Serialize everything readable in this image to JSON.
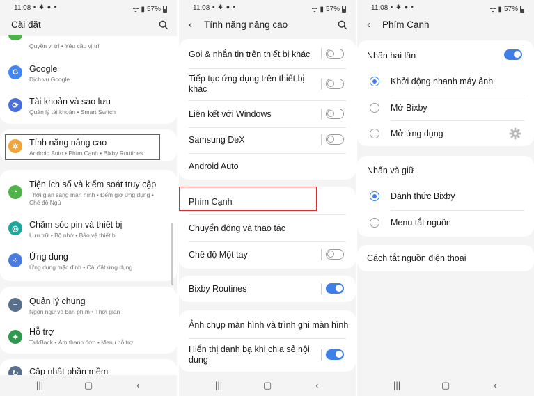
{
  "status_bar": {
    "time": "11:08",
    "battery": "57%"
  },
  "screen1": {
    "title": "Cài đặt",
    "partial_top_sub": "Quyền vị trí  •  Yêu cầu vị trí",
    "items": [
      {
        "label": "Google",
        "sub": "Dịch vụ Google",
        "icon": "google-icon",
        "color": "#4285f4"
      },
      {
        "label": "Tài khoản và sao lưu",
        "sub": "Quản lý tài khoản  •  Smart Switch",
        "icon": "sync-icon",
        "color": "#4a6fd8"
      },
      {
        "label": "Tính năng nâng cao",
        "sub": "Android Auto  •  Phím Cạnh  •  Bixby Routines",
        "icon": "star-gear-icon",
        "color": "#f0a43a"
      },
      {
        "label": "Tiện ích số và kiểm soát truy cập",
        "sub": "Thời gian sáng màn hình  •  Đếm giờ ứng dụng  •  Chế độ Ngủ",
        "icon": "digital-wellbeing-icon",
        "color": "#4fb34a"
      },
      {
        "label": "Chăm sóc pin và thiết bị",
        "sub": "Lưu trữ  •  Bộ nhớ  •  Bảo vệ thiết bị",
        "icon": "device-care-icon",
        "color": "#1fa89a"
      },
      {
        "label": "Ứng dụng",
        "sub": "Ứng dụng mặc định  •  Cài đặt ứng dụng",
        "icon": "apps-icon",
        "color": "#4a7be0"
      },
      {
        "label": "Quản lý chung",
        "sub": "Ngôn ngữ và bàn phím  •  Thời gian",
        "icon": "sliders-icon",
        "color": "#5a6f8a"
      },
      {
        "label": "Hỗ trợ",
        "sub": "TalkBack  •  Âm thanh đơn  •  Menu hỗ trợ",
        "icon": "accessibility-icon",
        "color": "#2f9a4e"
      },
      {
        "label": "Cập nhật phần mềm",
        "sub": "",
        "icon": "update-icon",
        "color": "#5a6f8a"
      }
    ]
  },
  "screen2": {
    "title": "Tính năng nâng cao",
    "items": [
      {
        "label": "Gọi & nhắn tin trên thiết bị khác",
        "toggle": false
      },
      {
        "label": "Tiếp tục ứng dụng trên thiết bị khác",
        "toggle": false
      },
      {
        "label": "Liên kết với Windows",
        "toggle": false
      },
      {
        "label": "Samsung DeX",
        "toggle": false
      },
      {
        "label": "Android Auto"
      },
      {
        "label": "Phím Cạnh"
      },
      {
        "label": "Chuyển động và thao tác"
      },
      {
        "label": "Chế độ Một tay",
        "toggle": false
      },
      {
        "label": "Bixby Routines",
        "toggle": true
      },
      {
        "label": "Ảnh chụp màn hình và trình ghi màn hình"
      },
      {
        "label": "Hiển thị danh bạ khi chia sẻ nội dung",
        "toggle": true
      }
    ]
  },
  "screen3": {
    "title": "Phím Cạnh",
    "double_press": {
      "label": "Nhấn hai lần",
      "enabled": true,
      "options": [
        "Khởi động nhanh máy ảnh",
        "Mở Bixby",
        "Mở ứng dụng"
      ],
      "selected": 0
    },
    "press_hold": {
      "label": "Nhấn và giữ",
      "options": [
        "Đánh thức Bixby",
        "Menu tắt nguồn"
      ],
      "selected": 0
    },
    "power_off": "Cách tắt nguồn điện thoại"
  },
  "colors": {
    "accent": "#3e80e8",
    "highlight": "#d9312f"
  }
}
